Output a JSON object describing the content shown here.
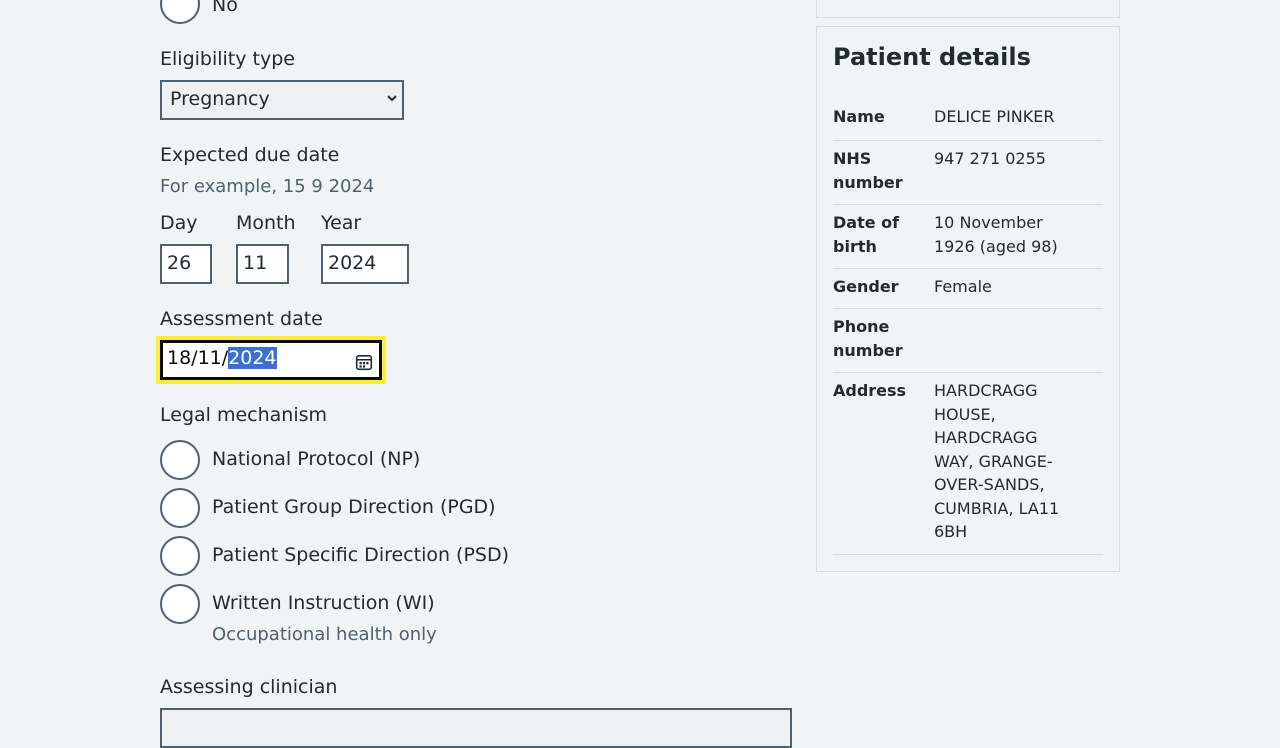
{
  "form": {
    "no_label": "No",
    "eligibility_label": "Eligibility type",
    "eligibility_value": "Pregnancy",
    "due_date_label": "Expected due date",
    "due_date_hint": "For example, 15 9 2024",
    "day_label": "Day",
    "month_label": "Month",
    "year_label": "Year",
    "day_value": "26",
    "month_value": "11",
    "year_value": "2024",
    "assessment_label": "Assessment date",
    "assessment_prefix": "18/11/",
    "assessment_selected": "2024",
    "legal_label": "Legal mechanism",
    "options": [
      {
        "label": "National Protocol (NP)"
      },
      {
        "label": "Patient Group Direction (PGD)"
      },
      {
        "label": "Patient Specific Direction (PSD)"
      },
      {
        "label": "Written Instruction (WI)"
      }
    ],
    "wi_hint": "Occupational health only",
    "clinician_label": "Assessing clinician"
  },
  "patient": {
    "title": "Patient details",
    "rows": [
      {
        "key": "Name",
        "value": "DELICE PINKER"
      },
      {
        "key": "NHS number",
        "value": "947 271 0255"
      },
      {
        "key": "Date of birth",
        "value": "10 November 1926 (aged 98)"
      },
      {
        "key": "Gender",
        "value": "Female"
      },
      {
        "key": "Phone number",
        "value": ""
      },
      {
        "key": "Address",
        "value": "HARDCRAGG HOUSE, HARDCRAGG WAY, GRANGE-OVER-SANDS, CUMBRIA, LA11 6BH"
      }
    ]
  }
}
